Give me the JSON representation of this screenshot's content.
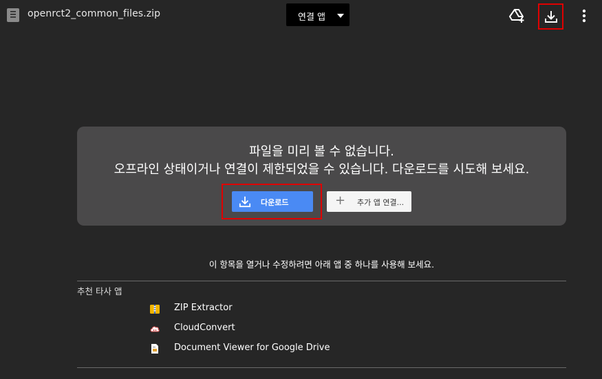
{
  "header": {
    "file_name": "openrct2_common_files.zip",
    "open_with_label": "연결 앱",
    "icons": [
      "file-icon",
      "add-to-drive-icon",
      "download-icon",
      "more-vert-icon"
    ]
  },
  "preview_error": {
    "line1": "파일을 미리 볼 수 없습니다.",
    "line2": "오프라인 상태이거나 연결이 제한되었을 수 있습니다. 다운로드를 시도해 보세요.",
    "download_label": "다운로드",
    "more_apps_label": "추가 앱 연결...",
    "more_apps_icon_glyph": "+"
  },
  "suggestion": {
    "hint": "이 항목을 열거나 수정하려면 아래 앱 중 하나를 사용해 보세요.",
    "section_title": "추천 타사 앱",
    "apps": [
      {
        "name": "ZIP Extractor",
        "icon": "zip-extractor-icon"
      },
      {
        "name": "CloudConvert",
        "icon": "cloudconvert-icon"
      },
      {
        "name": "Document Viewer for Google Drive",
        "icon": "document-viewer-icon"
      }
    ]
  },
  "colors": {
    "background": "#262626",
    "panel": "#4a494a",
    "download_button": "#4a8af4",
    "highlight": "#e00000"
  }
}
